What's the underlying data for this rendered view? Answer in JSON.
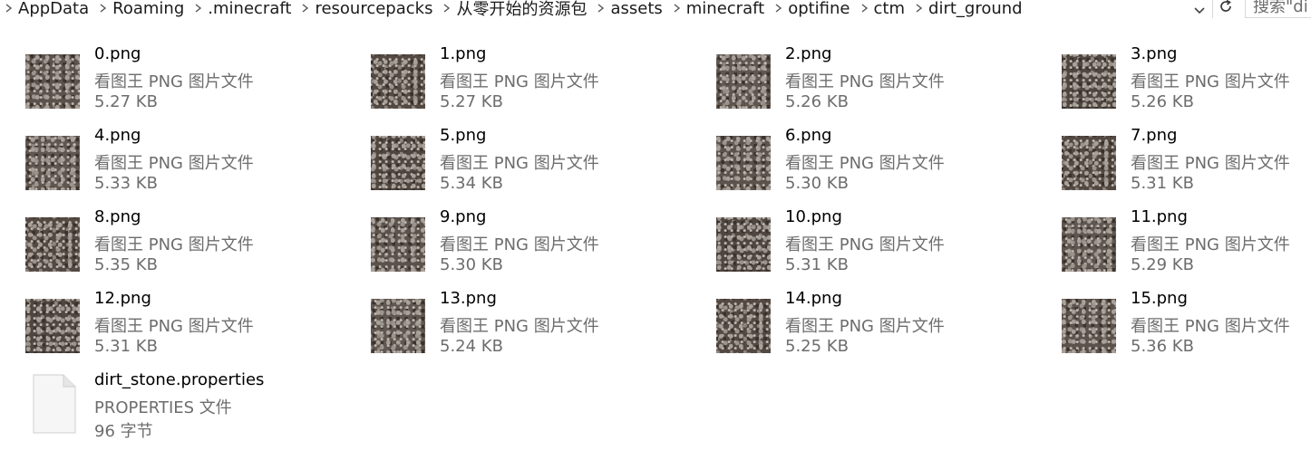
{
  "address_bar": {
    "crumbs": [
      "AppData",
      "Roaming",
      ".minecraft",
      "resourcepacks",
      "从零开始的资源包",
      "assets",
      "minecraft",
      "optifine",
      "ctm",
      "dirt_ground"
    ],
    "search_placeholder": "搜索\"di"
  },
  "files": [
    {
      "name": "0.png",
      "type": "看图王 PNG 图片文件",
      "size": "5.27 KB"
    },
    {
      "name": "1.png",
      "type": "看图王 PNG 图片文件",
      "size": "5.27 KB"
    },
    {
      "name": "2.png",
      "type": "看图王 PNG 图片文件",
      "size": "5.26 KB"
    },
    {
      "name": "3.png",
      "type": "看图王 PNG 图片文件",
      "size": "5.26 KB"
    },
    {
      "name": "4.png",
      "type": "看图王 PNG 图片文件",
      "size": "5.33 KB"
    },
    {
      "name": "5.png",
      "type": "看图王 PNG 图片文件",
      "size": "5.34 KB"
    },
    {
      "name": "6.png",
      "type": "看图王 PNG 图片文件",
      "size": "5.30 KB"
    },
    {
      "name": "7.png",
      "type": "看图王 PNG 图片文件",
      "size": "5.31 KB"
    },
    {
      "name": "8.png",
      "type": "看图王 PNG 图片文件",
      "size": "5.35 KB"
    },
    {
      "name": "9.png",
      "type": "看图王 PNG 图片文件",
      "size": "5.30 KB"
    },
    {
      "name": "10.png",
      "type": "看图王 PNG 图片文件",
      "size": "5.31 KB"
    },
    {
      "name": "11.png",
      "type": "看图王 PNG 图片文件",
      "size": "5.29 KB"
    },
    {
      "name": "12.png",
      "type": "看图王 PNG 图片文件",
      "size": "5.31 KB"
    },
    {
      "name": "13.png",
      "type": "看图王 PNG 图片文件",
      "size": "5.24 KB"
    },
    {
      "name": "14.png",
      "type": "看图王 PNG 图片文件",
      "size": "5.25 KB"
    },
    {
      "name": "15.png",
      "type": "看图王 PNG 图片文件",
      "size": "5.36 KB"
    },
    {
      "name": "dirt_stone.properties",
      "type": "PROPERTIES 文件",
      "size": "96 字节",
      "icon": "document-icon"
    }
  ]
}
